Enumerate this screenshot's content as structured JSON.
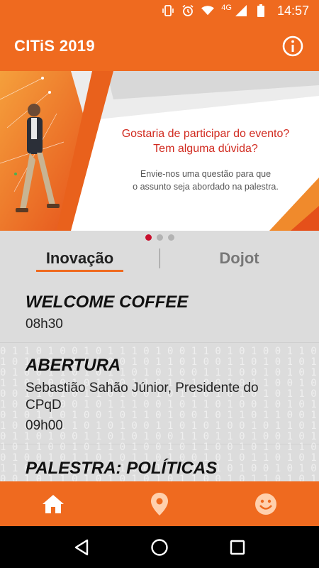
{
  "status_bar": {
    "network": "4G",
    "time": "14:57",
    "icons": [
      "vibrate-icon",
      "alarm-icon",
      "wifi-icon",
      "signal-icon",
      "battery-icon"
    ]
  },
  "app_bar": {
    "title": "CITiS 2019",
    "info_icon": "info-icon"
  },
  "banner": {
    "headline_line1": "Gostaria de participar do evento?",
    "headline_line2": "Tem alguma dúvida?",
    "sub_line1": "Envie-nos uma questão para que",
    "sub_line2": "o assunto seja abordado na palestra.",
    "page_count": 3,
    "active_page": 1
  },
  "tabs": [
    {
      "label": "Inovação",
      "active": true
    },
    {
      "label": "Dojot",
      "active": false
    }
  ],
  "schedule": [
    {
      "title": "WELCOME COFFEE",
      "desc": "",
      "time": "08h30"
    },
    {
      "title": "ABERTURA",
      "desc": "Sebastião Sahão Júnior, Presidente do CPqD",
      "time": "09h00"
    },
    {
      "title": "PALESTRA: POLÍTICAS",
      "desc": "",
      "time": ""
    }
  ],
  "bottom_nav": [
    {
      "icon": "home-icon",
      "active": true
    },
    {
      "icon": "location-pin-icon",
      "active": false
    },
    {
      "icon": "smiley-icon",
      "active": false
    }
  ],
  "colors": {
    "brand_orange": "#ef6a1f",
    "headline_red": "#d12b20",
    "active_dot": "#c8102e"
  }
}
